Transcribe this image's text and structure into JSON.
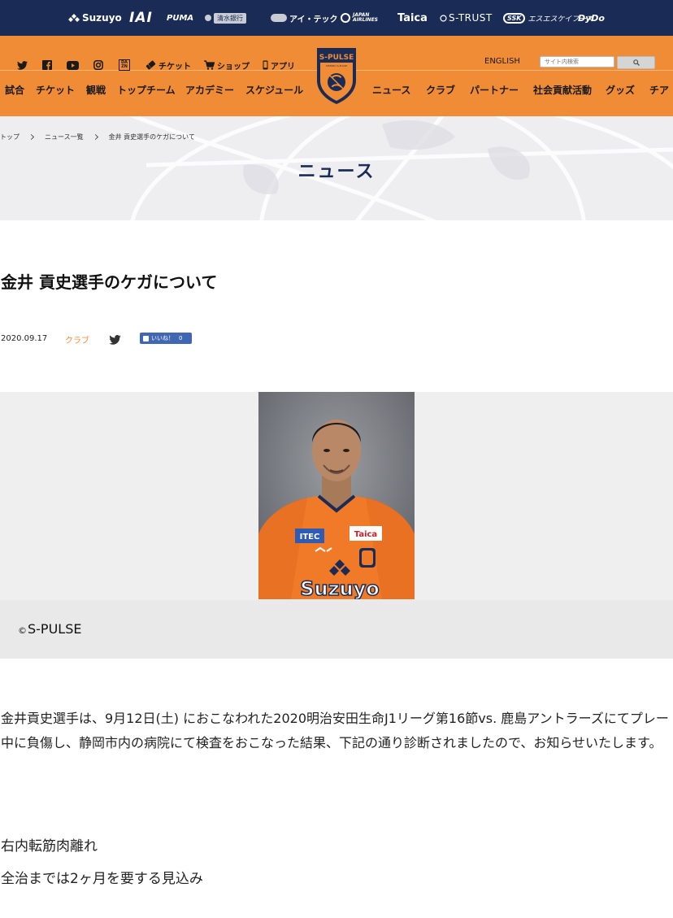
{
  "sponsors": {
    "suzuyo": "Suzuyo",
    "iai": "IAI",
    "puma": "PUMA",
    "shimizu": "清水銀行",
    "itec": "アイ・テック",
    "jal_top": "JAPAN",
    "jal_bottom": "AIRLINES",
    "taica": "Taica",
    "strust": "S-TRUST",
    "ssk_mark": "SSK",
    "ssk_name": "エスエスケイフーズ",
    "dydo": "DyDo"
  },
  "utility": {
    "ticket": "チケット",
    "shop": "ショップ",
    "app": "アプリ",
    "dazn_top": "DA",
    "dazn_bottom": "ZN",
    "english": "ENGLISH",
    "search_placeholder": "サイト内検索"
  },
  "logo": {
    "text": "S-PULSE",
    "sub": "SHIMIZU S-PULSE"
  },
  "nav": {
    "left": [
      "試合",
      "チケット",
      "観戦",
      "トップチーム",
      "アカデミー",
      "スケジュール"
    ],
    "right": [
      "ニュース",
      "クラブ",
      "パートナー",
      "社会貢献活動",
      "グッズ",
      "チア"
    ]
  },
  "breadcrumb": [
    "トップ",
    "ニュース一覧",
    "金井 貢史選手のケガについて"
  ],
  "hero_title": "ニュース",
  "article": {
    "title": "金井 貢史選手のケガについて",
    "date": "2020.09.17",
    "category": "クラブ",
    "fb_like_label": "いいね！",
    "fb_like_count": "0",
    "photo": {
      "shirt_sponsor": "Suzuyo",
      "chest_left": "ITEC",
      "chest_right": "Taica"
    },
    "caption_mark": "©",
    "caption": "S-PULSE",
    "body": "金井貢史選手は、9月12日(土) におこなわれた2020明治安田生命J1リーグ第16節vs. 鹿島アントラーズにてプレー中に負傷し、静岡市内の病院にて検査をおこなった結果、下記の通り診断されましたので、お知らせいたします。",
    "diagnosis": "右内転筋肉離れ",
    "recovery": "全治までは2ヶ月を要する見込み"
  },
  "colors": {
    "navy": "#1a2c56",
    "orange": "#f08c35",
    "hero_bg": "#eeeef1",
    "caption_bg": "#e9e9e9",
    "facebook": "#4267b2"
  },
  "icons": [
    "twitter-icon",
    "facebook-icon",
    "youtube-icon",
    "instagram-icon",
    "dazn-icon",
    "ticket-icon",
    "cart-icon",
    "phone-icon",
    "search-icon",
    "chevron-right-icon"
  ]
}
